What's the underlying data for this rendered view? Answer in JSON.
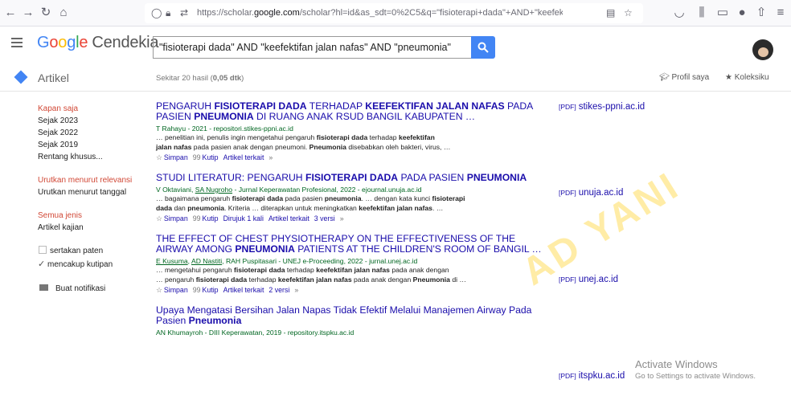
{
  "browser": {
    "url_prefix": "https://scholar.",
    "url_domain": "google.com",
    "url_suffix": "/scholar?hl=id&as_sdt=0%2C5&q=\"fisioterapi+dada\"+AND+\"keefektifan+jalan"
  },
  "header": {
    "logo_g": "Google",
    "logo_rest": "Cendekia",
    "search_value": "\"fisioterapi dada\" AND \"keefektifan jalan nafas\" AND \"pneumonia\""
  },
  "subheader": {
    "section": "Artikel",
    "stats": "Sekitar 20 hasil (0,05 dtk)",
    "profile": "Profil saya",
    "library": "Koleksiku"
  },
  "sidebar": {
    "time": [
      "Kapan saja",
      "Sejak 2023",
      "Sejak 2022",
      "Sejak 2019",
      "Rentang khusus..."
    ],
    "sort": [
      "Urutkan menurut relevansi",
      "Urutkan menurut tanggal"
    ],
    "type": [
      "Semua jenis",
      "Artikel kajian"
    ],
    "include_patents": "sertakan paten",
    "include_citations": "mencakup kutipan",
    "alert": "Buat notifikasi"
  },
  "results": [
    {
      "title_html": "PENGARUH <b>FISIOTERAPI DADA</b> TERHADAP <b>KEEFEKTIFAN JALAN NAFAS</b> PADA PASIEN <b>PNEUMONIA</b> DI RUANG ANAK RSUD BANGIL KABUPATEN …",
      "authors_html": "T Rahayu - 2021 - repositori.stikes-ppni.ac.id",
      "snippet_html": "… penelitian ini, penulis ingin mengetahui pengaruh <b>fisioterapi dada</b> terhadap <b>keefektifan</b><br><b>jalan nafas</b> pada pasien anak dengan pneumoni. <b>Pneumonia</b> disebabkan oleh bakteri, virus, …",
      "save": "Simpan",
      "cite": "Kutip",
      "cited_by": "",
      "related": "Artikel terkait",
      "versions": "",
      "pdf_tag": "[PDF]",
      "pdf_site": "stikes-ppni.ac.id"
    },
    {
      "title_html": "STUDI LITERATUR: PENGARUH <b>FISIOTERAPI DADA</b> PADA PASIEN <b>PNEUMONIA</b>",
      "authors_html": "V Oktaviani, <u>SA Nugroho</u> - Jurnal Keperawatan Profesional, 2022 - ejournal.unuja.ac.id",
      "snippet_html": "… bagaimana pengaruh <b>fisioterapi dada</b> pada pasien <b>pneumonia</b>. … dengan kata kunci <b>fisioterapi</b><br><b>dada</b> dan <b>pneumonia</b>. Kriteria … diterapkan untuk meningkatkan <b>keefektifan jalan nafas</b>. …",
      "save": "Simpan",
      "cite": "Kutip",
      "cited_by": "Dirujuk 1 kali",
      "related": "Artikel terkait",
      "versions": "3 versi",
      "pdf_tag": "[PDF]",
      "pdf_site": "unuja.ac.id"
    },
    {
      "title_html": "THE EFFECT OF CHEST PHYSIOTHERAPY ON THE EFFECTIVENESS OF THE AIRWAY AMONG <b>PNEUMONIA</b> PATIENTS AT THE CHILDREN'S ROOM OF BANGIL …",
      "authors_html": "<u>E Kusuma</u>, <u>AD Nastiti</u>, RAH Puspitasari - UNEJ e-Proceeding, 2022 - jurnal.unej.ac.id",
      "snippet_html": "… mengetahui pengaruh <b>fisioterapi dada</b> terhadap <b>keefektifan jalan nafas</b> pada anak dengan<br>… pengaruh <b>fisioterapi dada</b> terhadap <b>keefektifan jalan nafas</b> pada anak dengan <b>Pneumonia</b> di …",
      "save": "Simpan",
      "cite": "Kutip",
      "cited_by": "",
      "related": "Artikel terkait",
      "versions": "2 versi",
      "pdf_tag": "[PDF]",
      "pdf_site": "unej.ac.id"
    },
    {
      "title_html": "Upaya Mengatasi Bersihan Jalan Napas Tidak Efektif Melalui Manajemen Airway Pada Pasien <b>Pneumonia</b>",
      "authors_html": "AN Khumayroh - DIII Keperawatan, 2019 - repository.itspku.ac.id",
      "snippet_html": "",
      "save": "",
      "cite": "",
      "cited_by": "",
      "related": "",
      "versions": "",
      "pdf_tag": "[PDF]",
      "pdf_site": "itspku.ac.id"
    }
  ],
  "watermark": {
    "title": "Activate Windows",
    "sub": "Go to Settings to activate Windows.",
    "overlay": "AD YANI"
  }
}
